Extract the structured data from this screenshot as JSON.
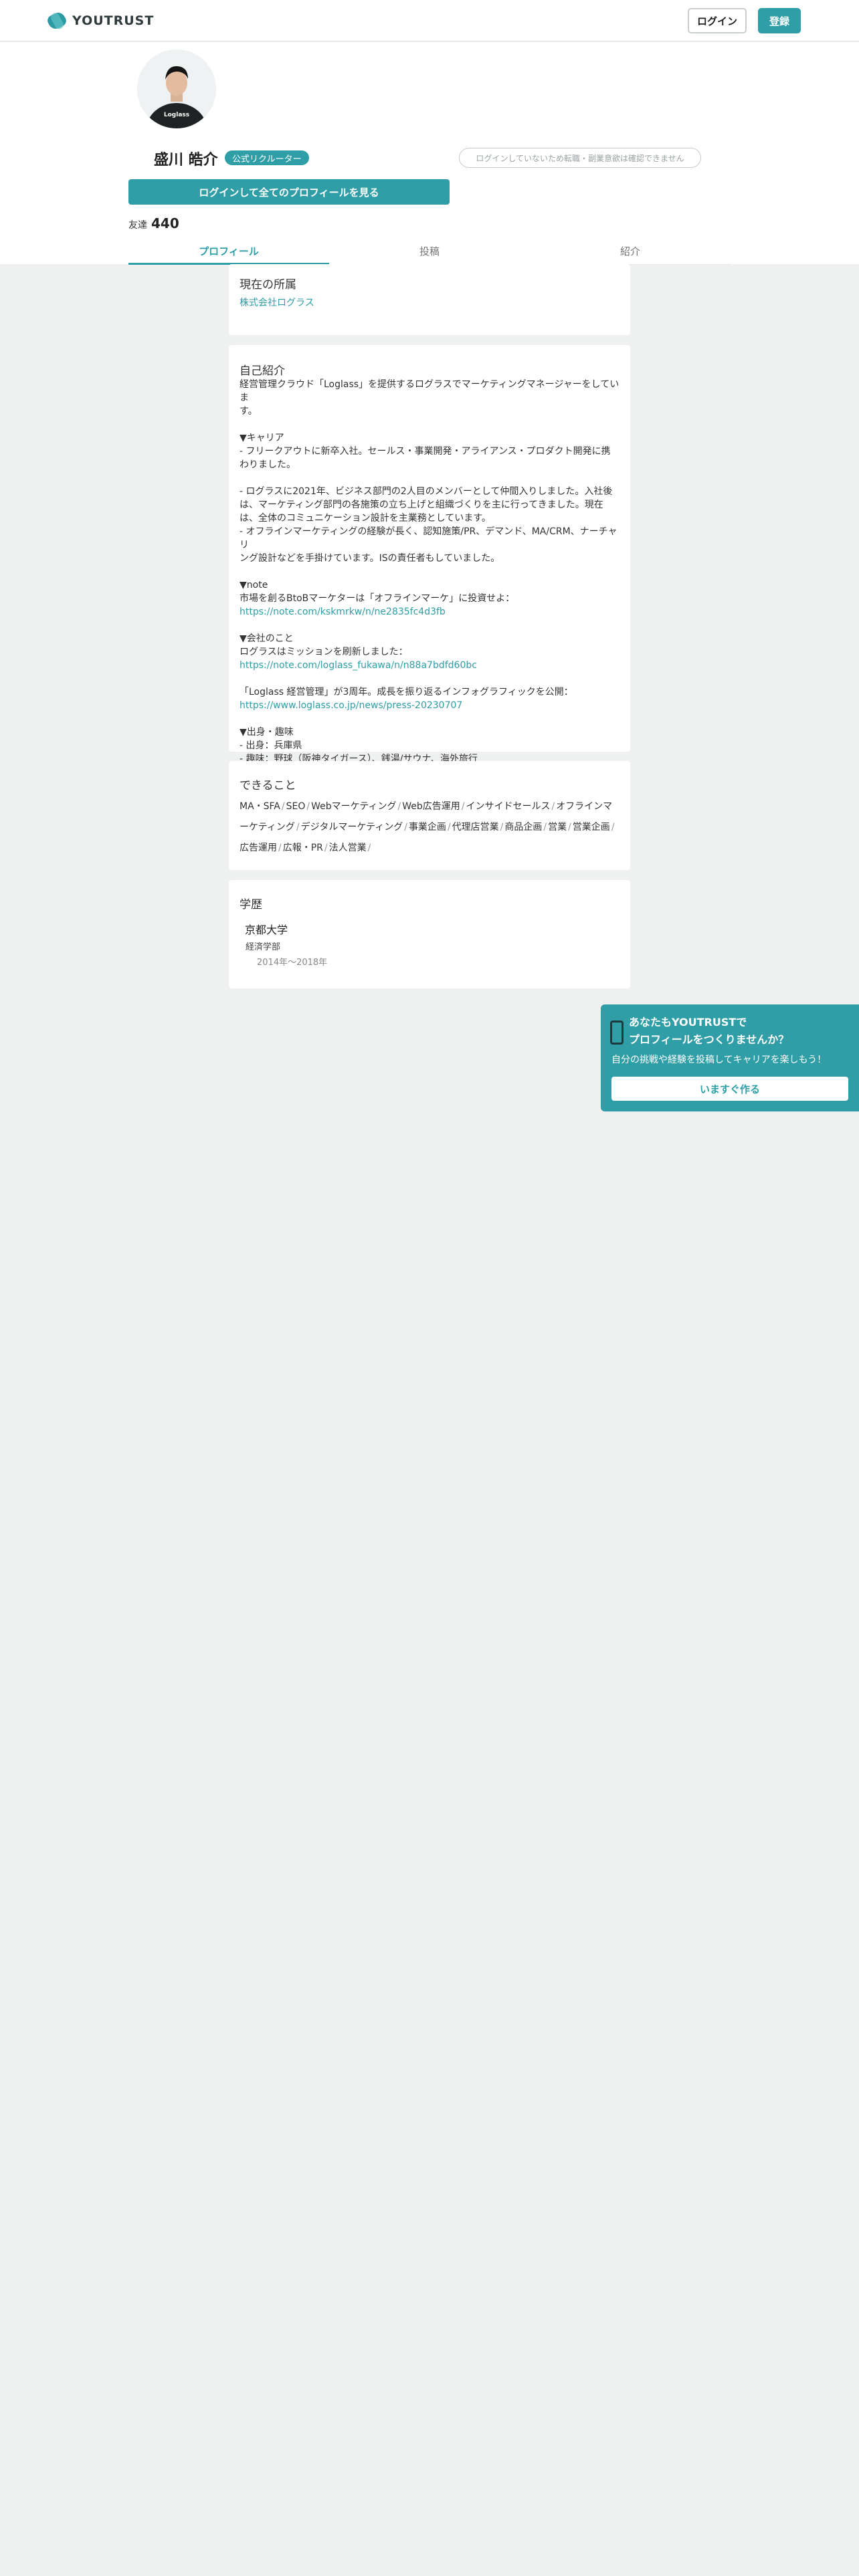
{
  "header": {
    "logo_text": "YOUTRUST",
    "login_label": "ログイン",
    "register_label": "登録"
  },
  "profile": {
    "name": "盛川 皓介",
    "badge": "公式リクルーター",
    "notice": "ログインしていないため転職・副業意欲は確認できません",
    "cta": "ログインして全てのプロフィールを見る",
    "friends_label": "友達",
    "friends_count": "440",
    "shirt_text": "Loglass"
  },
  "tabs": [
    {
      "label": "プロフィール",
      "active": true
    },
    {
      "label": "投稿",
      "active": false
    },
    {
      "label": "紹介",
      "active": false
    }
  ],
  "affiliation": {
    "title": "現在の所属",
    "company": "株式会社ログラス"
  },
  "intro": {
    "title": "自己紹介",
    "lines": [
      {
        "text": "経営管理クラウド「Loglass」を提供するログラスでマーケティングマネージャーをしていま",
        "link": false
      },
      {
        "text": "す。",
        "link": false
      },
      {
        "text": "",
        "link": false
      },
      {
        "text": "▼キャリア",
        "link": false
      },
      {
        "text": "- フリークアウトに新卒入社。セールス・事業開発・アライアンス・プロダクト開発に携",
        "link": false
      },
      {
        "text": "わりました。",
        "link": false
      },
      {
        "text": "",
        "link": false
      },
      {
        "text": "- ログラスに2021年、ビジネス部門の2人目のメンバーとして仲間入りしました。入社後",
        "link": false
      },
      {
        "text": "は、マーケティング部門の各施策の立ち上げと組織づくりを主に行ってきました。現在",
        "link": false
      },
      {
        "text": "は、全体のコミュニケーション設計を主業務としています。",
        "link": false
      },
      {
        "text": "- オフラインマーケティングの経験が長く、認知施策/PR、デマンド、MA/CRM、ナーチャリ",
        "link": false
      },
      {
        "text": "ング設計などを手掛けています。ISの責任者もしていました。",
        "link": false
      },
      {
        "text": "",
        "link": false
      },
      {
        "text": "▼note",
        "link": false
      },
      {
        "text": "市場を創るBtoBマーケターは「オフラインマーケ」に投資せよ：",
        "link": false
      },
      {
        "text": "https://note.com/kskmrkw/n/ne2835fc4d3fb",
        "link": true
      },
      {
        "text": "",
        "link": false
      },
      {
        "text": "▼会社のこと",
        "link": false
      },
      {
        "text": "ログラスはミッションを刷新しました：",
        "link": false
      },
      {
        "text": "https://note.com/loglass_fukawa/n/n88a7bdfd60bc",
        "link": true
      },
      {
        "text": "",
        "link": false
      },
      {
        "text": "「Loglass 経営管理」が3周年。成長を振り返るインフォグラフィックを公開：",
        "link": false
      },
      {
        "text": "https://www.loglass.co.jp/news/press-20230707",
        "link": true
      },
      {
        "text": "",
        "link": false
      },
      {
        "text": "▼出身・趣味",
        "link": false
      },
      {
        "text": "- 出身：兵庫県",
        "link": false
      },
      {
        "text": "- 趣味：野球（阪神タイガース）、銭湯/サウナ、海外旅行",
        "link": false
      }
    ]
  },
  "skills": {
    "title": "できること",
    "items": [
      "MA・SFA",
      "SEO",
      "Webマーケティング",
      "Web広告運用",
      "インサイドセールス",
      "オフラインマーケティング",
      "デジタルマーケティング",
      "事業企画",
      "代理店営業",
      "商品企画",
      "営業",
      "営業企画",
      "広告運用",
      "広報・PR",
      "法人営業"
    ]
  },
  "education": {
    "title": "学歴",
    "school": "京都大学",
    "department": "経済学部",
    "period": "2014年〜2018年"
  },
  "banner": {
    "title_line1": "あなたもYOUTRUSTで",
    "title_line2": "プロフィールをつくりませんか？",
    "subtitle": "自分の挑戦や経験を投稿してキャリアを楽しもう！",
    "button": "いますぐ作る"
  },
  "colors": {
    "accent": "#2f9ea6",
    "background": "#eff0f0"
  }
}
